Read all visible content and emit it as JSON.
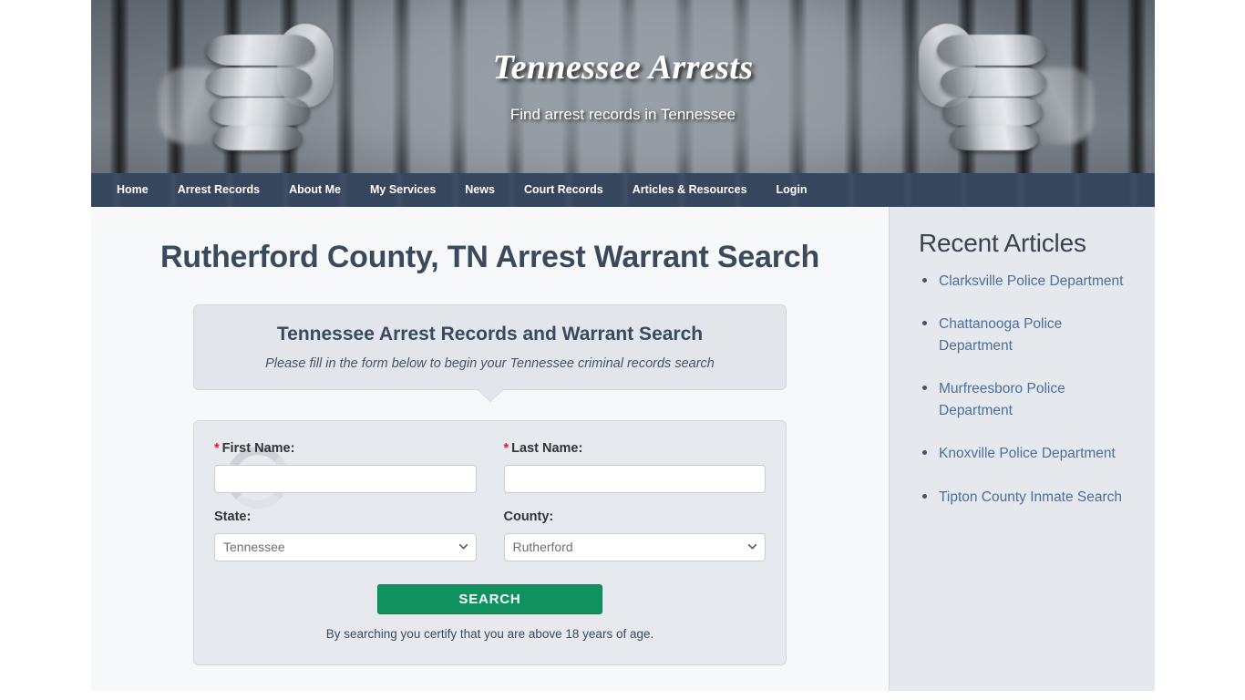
{
  "site": {
    "title": "Tennessee Arrests",
    "tagline": "Find arrest records in Tennessee",
    "hero_image_alt": "hands-gripping-jail-bars"
  },
  "nav": {
    "items": [
      {
        "label": "Home"
      },
      {
        "label": "Arrest Records"
      },
      {
        "label": "About Me"
      },
      {
        "label": "My Services"
      },
      {
        "label": "News"
      },
      {
        "label": "Court Records"
      },
      {
        "label": "Articles & Resources"
      },
      {
        "label": "Login"
      }
    ]
  },
  "main": {
    "page_title": "Rutherford County, TN Arrest Warrant Search",
    "callout": {
      "title": "Tennessee Arrest Records and Warrant Search",
      "subtitle": "Please fill in the form below to begin your Tennessee criminal records search"
    },
    "form": {
      "required_marker": "*",
      "first_name": {
        "label": "First Name:",
        "value": "",
        "placeholder": ""
      },
      "last_name": {
        "label": "Last Name:",
        "value": "",
        "placeholder": ""
      },
      "state": {
        "label": "State:",
        "selected": "Tennessee",
        "options": [
          "Tennessee"
        ]
      },
      "county": {
        "label": "County:",
        "selected": "Rutherford",
        "options": [
          "Rutherford"
        ]
      },
      "search_button": "SEARCH",
      "disclaimer": "By searching you certify that you are above 18 years of age."
    }
  },
  "sidebar": {
    "title": "Recent Articles",
    "articles": [
      {
        "label": "Clarksville Police Department"
      },
      {
        "label": "Chattanooga Police Department"
      },
      {
        "label": "Murfreesboro Police Department"
      },
      {
        "label": "Knoxville Police Department"
      },
      {
        "label": "Tipton County Inmate Search"
      }
    ]
  },
  "colors": {
    "nav_bg": "#273851",
    "title_text": "#3a4a5e",
    "button_green": "#0f9160",
    "link_blue": "#4a6f9e",
    "required_red": "#d81e2a",
    "sidebar_bg": "#e5e8ec",
    "main_bg": "#f7f8f9"
  }
}
